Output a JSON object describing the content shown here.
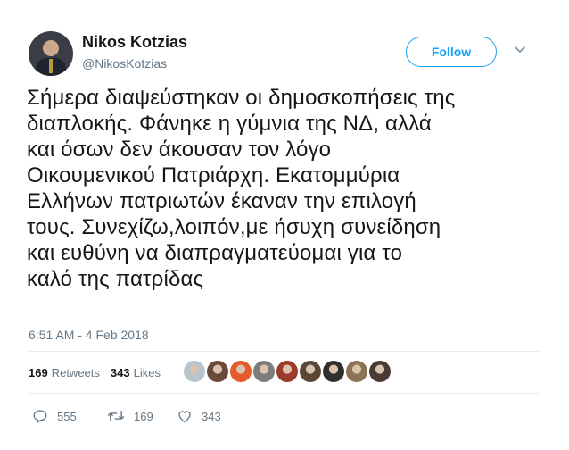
{
  "user": {
    "name": "Nikos Kotzias",
    "handle": "@NikosKotzias"
  },
  "follow_label": "Follow",
  "tweet_text": "Σήμερα διαψεύστηκαν οι δημοσκοπήσεις της\nδιαπλοκής. Φάνηκε η γύμνια της ΝΔ, αλλά\nκαι όσων δεν άκουσαν τον λόγο\nΟικουμενικού Πατριάρχη. Εκατομμύρια\nΕλλήνων πατριωτών έκαναν την επιλογή\nτους. Συνεχίζω,λοιπόν,με ήσυχη συνείδηση\nκαι ευθύνη να διαπραγματεύομαι για το\nκαλό της πατρίδας",
  "timestamp": "6:51 AM - 4 Feb 2018",
  "stats": {
    "retweets_count": "169",
    "retweets_label": "Retweets",
    "likes_count": "343",
    "likes_label": "Likes"
  },
  "likers": [
    {
      "color": "#b8c4cc"
    },
    {
      "color": "#6b4a3a"
    },
    {
      "color": "#e35b2b"
    },
    {
      "color": "#7d7d7d"
    },
    {
      "color": "#9c3b2c"
    },
    {
      "color": "#5a4636"
    },
    {
      "color": "#2f2f2f"
    },
    {
      "color": "#8b7355"
    },
    {
      "color": "#4a3a33"
    }
  ],
  "actions": {
    "replies": "555",
    "retweets": "169",
    "likes": "343"
  },
  "colors": {
    "accent": "#1da1f2",
    "secondary_text": "#657786",
    "divider": "#e6ecf0"
  }
}
